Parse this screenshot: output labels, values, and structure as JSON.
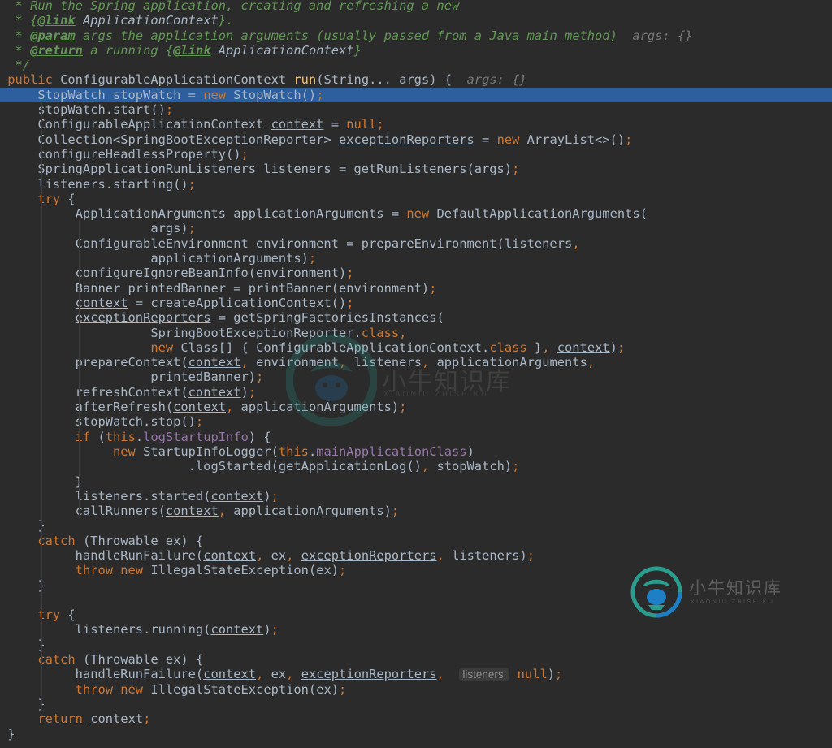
{
  "editor": {
    "lines": [
      [
        {
          "t": "cm",
          "x": "  * Run the Spring application, creating and refreshing a new"
        }
      ],
      [
        {
          "t": "cm",
          "x": "  * {"
        },
        {
          "t": "tag",
          "x": "@link"
        },
        {
          "t": "ref",
          "x": " ApplicationContext"
        },
        {
          "t": "cm",
          "x": "}."
        }
      ],
      [
        {
          "t": "cm",
          "x": "  * "
        },
        {
          "t": "tag",
          "x": "@param"
        },
        {
          "t": "cm",
          "x": " args the application arguments (usually passed from a Java main method)  "
        },
        {
          "t": "hint",
          "x": "args: {}"
        }
      ],
      [
        {
          "t": "cm",
          "x": "  * "
        },
        {
          "t": "tag",
          "x": "@return"
        },
        {
          "t": "cm",
          "x": " a running {"
        },
        {
          "t": "tag",
          "x": "@link"
        },
        {
          "t": "ref",
          "x": " ApplicationContext"
        },
        {
          "t": "cm",
          "x": "}"
        }
      ],
      [
        {
          "t": "cm",
          "x": "  */"
        }
      ],
      [
        {
          "t": "",
          "x": " "
        },
        {
          "t": "kw",
          "x": "public"
        },
        {
          "t": "",
          "x": " ConfigurableApplicationContext "
        },
        {
          "t": "fn",
          "x": "run"
        },
        {
          "t": "",
          "x": "(String... args) {  "
        },
        {
          "t": "hint",
          "x": "args: {}"
        }
      ],
      [
        {
          "t": "",
          "x": "     StopWatch stopWatch = "
        },
        {
          "t": "kw",
          "x": "new"
        },
        {
          "t": "",
          "x": " StopWatch()"
        },
        {
          "t": "kw",
          "x": ";"
        }
      ],
      [
        {
          "t": "",
          "x": "     stopWatch.start()"
        },
        {
          "t": "kw",
          "x": ";"
        }
      ],
      [
        {
          "t": "",
          "x": "     ConfigurableApplicationContext "
        },
        {
          "t": "und",
          "x": "context"
        },
        {
          "t": "",
          "x": " = "
        },
        {
          "t": "kw",
          "x": "null;"
        }
      ],
      [
        {
          "t": "",
          "x": "     Collection<SpringBootExceptionReporter> "
        },
        {
          "t": "und",
          "x": "exceptionReporters"
        },
        {
          "t": "",
          "x": " = "
        },
        {
          "t": "kw",
          "x": "new"
        },
        {
          "t": "",
          "x": " ArrayList<>()"
        },
        {
          "t": "kw",
          "x": ";"
        }
      ],
      [
        {
          "t": "",
          "x": "     configureHeadlessProperty()"
        },
        {
          "t": "kw",
          "x": ";"
        }
      ],
      [
        {
          "t": "",
          "x": "     SpringApplicationRunListeners listeners = getRunListeners(args)"
        },
        {
          "t": "kw",
          "x": ";"
        }
      ],
      [
        {
          "t": "",
          "x": "     listeners.starting()"
        },
        {
          "t": "kw",
          "x": ";"
        }
      ],
      [
        {
          "t": "",
          "x": "     "
        },
        {
          "t": "kw",
          "x": "try"
        },
        {
          "t": "",
          "x": " {"
        }
      ],
      [
        {
          "t": "",
          "x": "          ApplicationArguments applicationArguments = "
        },
        {
          "t": "kw",
          "x": "new"
        },
        {
          "t": "",
          "x": " DefaultApplicationArguments("
        }
      ],
      [
        {
          "t": "",
          "x": "                    args)"
        },
        {
          "t": "kw",
          "x": ";"
        }
      ],
      [
        {
          "t": "",
          "x": "          ConfigurableEnvironment environment = prepareEnvironment(listeners"
        },
        {
          "t": "kw",
          "x": ","
        }
      ],
      [
        {
          "t": "",
          "x": "                    applicationArguments)"
        },
        {
          "t": "kw",
          "x": ";"
        }
      ],
      [
        {
          "t": "",
          "x": "          configureIgnoreBeanInfo(environment)"
        },
        {
          "t": "kw",
          "x": ";"
        }
      ],
      [
        {
          "t": "",
          "x": "          Banner printedBanner = printBanner(environment)"
        },
        {
          "t": "kw",
          "x": ";"
        }
      ],
      [
        {
          "t": "",
          "x": "          "
        },
        {
          "t": "und",
          "x": "context"
        },
        {
          "t": "",
          "x": " = createApplicationContext()"
        },
        {
          "t": "kw",
          "x": ";"
        }
      ],
      [
        {
          "t": "",
          "x": "          "
        },
        {
          "t": "und",
          "x": "exceptionReporters"
        },
        {
          "t": "",
          "x": " = getSpringFactoriesInstances("
        }
      ],
      [
        {
          "t": "",
          "x": "                    SpringBootExceptionReporter."
        },
        {
          "t": "kw",
          "x": "class,"
        }
      ],
      [
        {
          "t": "",
          "x": "                    "
        },
        {
          "t": "kw",
          "x": "new"
        },
        {
          "t": "",
          "x": " Class[] { ConfigurableApplicationContext."
        },
        {
          "t": "kw",
          "x": "class"
        },
        {
          "t": "",
          "x": " }"
        },
        {
          "t": "kw",
          "x": ", "
        },
        {
          "t": "und",
          "x": "context"
        },
        {
          "t": "",
          "x": ")"
        },
        {
          "t": "kw",
          "x": ";"
        }
      ],
      [
        {
          "t": "",
          "x": "          prepareContext("
        },
        {
          "t": "und",
          "x": "context"
        },
        {
          "t": "kw",
          "x": ","
        },
        {
          "t": "",
          "x": " environment"
        },
        {
          "t": "kw",
          "x": ","
        },
        {
          "t": "",
          "x": " listeners"
        },
        {
          "t": "kw",
          "x": ","
        },
        {
          "t": "",
          "x": " applicationArguments"
        },
        {
          "t": "kw",
          "x": ","
        }
      ],
      [
        {
          "t": "",
          "x": "                    printedBanner)"
        },
        {
          "t": "kw",
          "x": ";"
        }
      ],
      [
        {
          "t": "",
          "x": "          refreshContext("
        },
        {
          "t": "und",
          "x": "context"
        },
        {
          "t": "",
          "x": ")"
        },
        {
          "t": "kw",
          "x": ";"
        }
      ],
      [
        {
          "t": "",
          "x": "          afterRefresh("
        },
        {
          "t": "und",
          "x": "context"
        },
        {
          "t": "kw",
          "x": ","
        },
        {
          "t": "",
          "x": " applicationArguments)"
        },
        {
          "t": "kw",
          "x": ";"
        }
      ],
      [
        {
          "t": "",
          "x": "          stopWatch.stop()"
        },
        {
          "t": "kw",
          "x": ";"
        }
      ],
      [
        {
          "t": "",
          "x": "          "
        },
        {
          "t": "kw",
          "x": "if"
        },
        {
          "t": "",
          "x": " ("
        },
        {
          "t": "kw",
          "x": "this"
        },
        {
          "t": "",
          "x": "."
        },
        {
          "t": "fld",
          "x": "logStartupInfo"
        },
        {
          "t": "",
          "x": ") {"
        }
      ],
      [
        {
          "t": "",
          "x": "               "
        },
        {
          "t": "kw",
          "x": "new"
        },
        {
          "t": "",
          "x": " StartupInfoLogger("
        },
        {
          "t": "kw",
          "x": "this"
        },
        {
          "t": "",
          "x": "."
        },
        {
          "t": "fld",
          "x": "mainApplicationClass"
        },
        {
          "t": "",
          "x": ")"
        }
      ],
      [
        {
          "t": "",
          "x": "                         .logStarted(getApplicationLog()"
        },
        {
          "t": "kw",
          "x": ","
        },
        {
          "t": "",
          "x": " stopWatch)"
        },
        {
          "t": "kw",
          "x": ";"
        }
      ],
      [
        {
          "t": "",
          "x": "          }"
        }
      ],
      [
        {
          "t": "",
          "x": "          listeners.started("
        },
        {
          "t": "und",
          "x": "context"
        },
        {
          "t": "",
          "x": ")"
        },
        {
          "t": "kw",
          "x": ";"
        }
      ],
      [
        {
          "t": "",
          "x": "          callRunners("
        },
        {
          "t": "und",
          "x": "context"
        },
        {
          "t": "kw",
          "x": ","
        },
        {
          "t": "",
          "x": " applicationArguments)"
        },
        {
          "t": "kw",
          "x": ";"
        }
      ],
      [
        {
          "t": "",
          "x": "     }"
        }
      ],
      [
        {
          "t": "",
          "x": "     "
        },
        {
          "t": "kw",
          "x": "catch"
        },
        {
          "t": "",
          "x": " (Throwable ex) {"
        }
      ],
      [
        {
          "t": "",
          "x": "          handleRunFailure("
        },
        {
          "t": "und",
          "x": "context"
        },
        {
          "t": "kw",
          "x": ","
        },
        {
          "t": "",
          "x": " ex"
        },
        {
          "t": "kw",
          "x": ","
        },
        {
          "t": "",
          "x": " "
        },
        {
          "t": "und",
          "x": "exceptionReporters"
        },
        {
          "t": "kw",
          "x": ","
        },
        {
          "t": "",
          "x": " listeners)"
        },
        {
          "t": "kw",
          "x": ";"
        }
      ],
      [
        {
          "t": "",
          "x": "          "
        },
        {
          "t": "kw",
          "x": "throw new"
        },
        {
          "t": "",
          "x": " IllegalStateException(ex)"
        },
        {
          "t": "kw",
          "x": ";"
        }
      ],
      [
        {
          "t": "",
          "x": "     }"
        }
      ],
      [
        {
          "t": "",
          "x": ""
        }
      ],
      [
        {
          "t": "",
          "x": "     "
        },
        {
          "t": "kw",
          "x": "try"
        },
        {
          "t": "",
          "x": " {"
        }
      ],
      [
        {
          "t": "",
          "x": "          listeners.running("
        },
        {
          "t": "und",
          "x": "context"
        },
        {
          "t": "",
          "x": ")"
        },
        {
          "t": "kw",
          "x": ";"
        }
      ],
      [
        {
          "t": "",
          "x": "     }"
        }
      ],
      [
        {
          "t": "",
          "x": "     "
        },
        {
          "t": "kw",
          "x": "catch"
        },
        {
          "t": "",
          "x": " (Throwable ex) {"
        }
      ],
      [
        {
          "t": "",
          "x": "          handleRunFailure("
        },
        {
          "t": "und",
          "x": "context"
        },
        {
          "t": "kw",
          "x": ","
        },
        {
          "t": "",
          "x": " ex"
        },
        {
          "t": "kw",
          "x": ","
        },
        {
          "t": "",
          "x": " "
        },
        {
          "t": "und",
          "x": "exceptionReporters"
        },
        {
          "t": "kw",
          "x": ","
        },
        {
          "t": "",
          "x": "  "
        },
        {
          "t": "hintbox",
          "x": "listeners:"
        },
        {
          "t": "",
          "x": " "
        },
        {
          "t": "kw",
          "x": "null"
        },
        {
          "t": "",
          "x": ")"
        },
        {
          "t": "kw",
          "x": ";"
        }
      ],
      [
        {
          "t": "",
          "x": "          "
        },
        {
          "t": "kw",
          "x": "throw new"
        },
        {
          "t": "",
          "x": " IllegalStateException(ex)"
        },
        {
          "t": "kw",
          "x": ";"
        }
      ],
      [
        {
          "t": "",
          "x": "     }"
        }
      ],
      [
        {
          "t": "",
          "x": "     "
        },
        {
          "t": "kw",
          "x": "return"
        },
        {
          "t": "",
          "x": " "
        },
        {
          "t": "und",
          "x": "context"
        },
        {
          "t": "kw",
          "x": ";"
        }
      ],
      [
        {
          "t": "",
          "x": " }"
        }
      ]
    ],
    "highlighted_line": 6,
    "guide_lines": [
      {
        "col": 5,
        "from": 6,
        "to": 48
      },
      {
        "col": 10,
        "from": 14,
        "to": 35
      }
    ]
  },
  "watermark": {
    "brand_text": "小牛知识库",
    "sub_text": "XIAONIU ZHISHIKU",
    "colors": {
      "teal": "#2a9d8f",
      "blue": "#1f7fc4",
      "gray": "#8a8a8a"
    }
  },
  "theme": {
    "background": "#2b2b2b",
    "text": "#a9b7c6",
    "keyword": "#cc7832",
    "method": "#ffc66d",
    "comment": "#629755",
    "field": "#9876aa",
    "selection": "#2d5f9e"
  }
}
